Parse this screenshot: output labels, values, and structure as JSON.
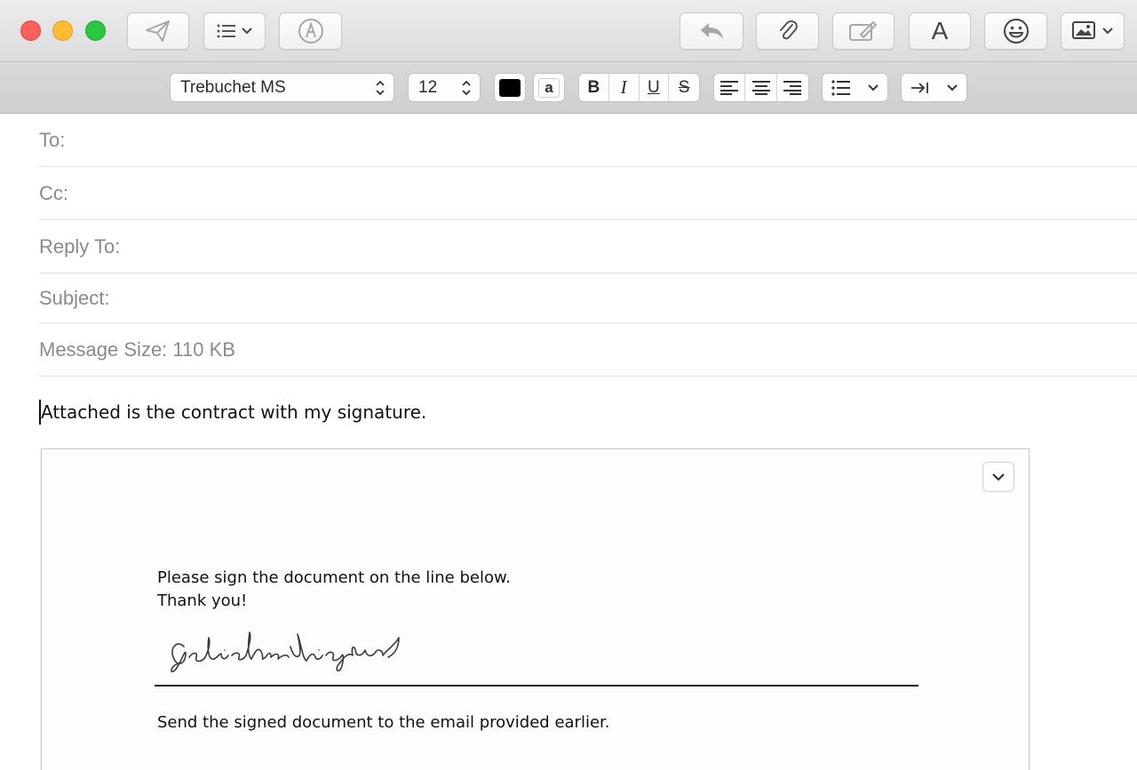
{
  "toolbar": {
    "send_icon": "paper-plane-icon",
    "header_fields_icon": "list-icon",
    "markup_icon": "markup-pen-icon",
    "reply_icon": "reply-arrow-icon",
    "attach_icon": "paperclip-icon",
    "attach_sig_icon": "signature-icon",
    "format_label": "A",
    "emoji_icon": "smiley-icon",
    "photo_icon": "photo-browser-icon"
  },
  "format_bar": {
    "font_family": "Trebuchet MS",
    "font_size": "12",
    "text_color": "#000000",
    "bg_color_label": "a",
    "bold": "B",
    "italic": "I",
    "underline": "U",
    "strikethrough": "S"
  },
  "fields": {
    "to_label": "To:",
    "cc_label": "Cc:",
    "reply_to_label": "Reply To:",
    "subject_label": "Subject:",
    "message_size": "Message Size: 110 KB"
  },
  "message": {
    "body": "Attached is the contract with my signature."
  },
  "attachment": {
    "line1": "Please sign the document on the line below.",
    "line2": "Thank you!",
    "footer": "Send the signed document to the email provided earlier.",
    "signature_image": "handwritten-signature"
  }
}
